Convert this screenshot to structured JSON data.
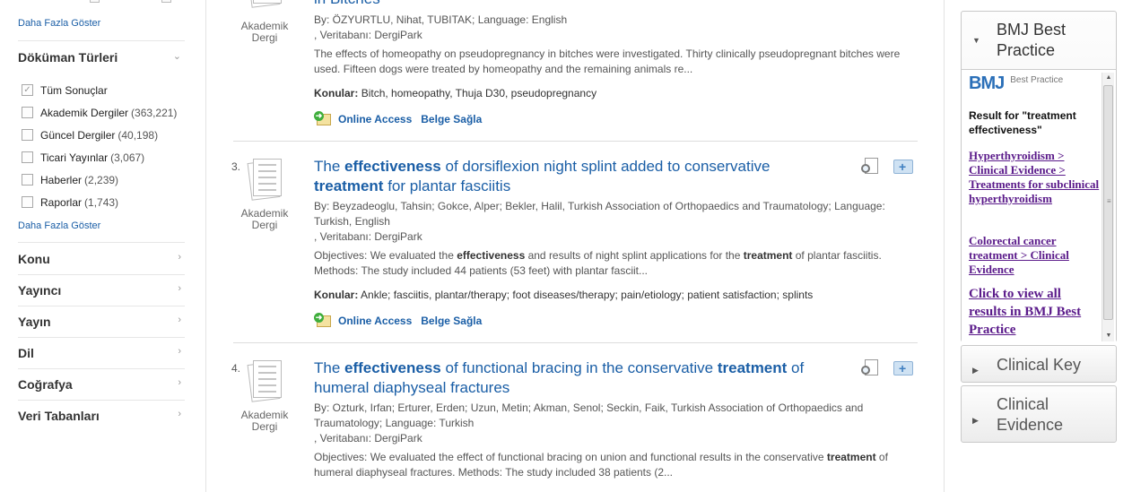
{
  "sidebar": {
    "show_more_top": "Daha Fazla Göster",
    "doc_types_title": "Döküman Türleri",
    "doc_types": [
      {
        "label": "Tüm Sonuçlar",
        "count": ""
      },
      {
        "label": "Akademik Dergiler",
        "count": "(363,221)"
      },
      {
        "label": "Güncel Dergiler",
        "count": "(40,198)"
      },
      {
        "label": "Ticari Yayınlar",
        "count": "(3,067)"
      },
      {
        "label": "Haberler",
        "count": "(2,239)"
      },
      {
        "label": "Raporlar",
        "count": "(1,743)"
      }
    ],
    "show_more": "Daha Fazla Göster",
    "facets": [
      "Konu",
      "Yayıncı",
      "Yayın",
      "Dil",
      "Coğrafya",
      "Veri Tabanları"
    ]
  },
  "results": [
    {
      "number": "",
      "doc_type": "Akademik Dergi",
      "title_tail": "in Bitches",
      "byline": "By: ÖZYURTLU, Nihat, TUBITAK; Language: English",
      "database": ", Veritabanı: DergiPark",
      "abstract": "The effects of homeopathy on pseudopregnancy in bitches were investigated. Thirty clinically pseudopregnant bitches were used. Fifteen dogs were treated by homeopathy and the remaining animals re...",
      "subjects_label": "Konular:",
      "subjects": "Bitch, homeopathy, Thuja D30, pseudopregnancy",
      "online_access": "Online Access",
      "provide_doc": "Belge Sağla"
    },
    {
      "number": "3.",
      "doc_type": "Akademik Dergi",
      "title_parts": [
        "The ",
        "effectiveness",
        " of dorsiflexion night splint added to conservative ",
        "treatment",
        " for plantar fasciitis"
      ],
      "byline": "By: Beyzadeoglu, Tahsin; Gokce, Alper; Bekler, Halil, Turkish Association of Orthopaedics and Traumatology; Language: Turkish, English",
      "database": ", Veritabanı: DergiPark",
      "abstract_parts": [
        "Objectives: We evaluated the ",
        "effectiveness",
        " and results of night splint applications for the ",
        "treatment",
        " of plantar fasciitis. Methods: The study included 44 patients (53 feet) with plantar fasciit..."
      ],
      "subjects_label": "Konular:",
      "subjects": "Ankle; fasciitis, plantar/therapy; foot diseases/therapy; pain/etiology; patient satisfaction; splints",
      "online_access": "Online Access",
      "provide_doc": "Belge Sağla"
    },
    {
      "number": "4.",
      "doc_type": "Akademik Dergi",
      "title_parts": [
        "The ",
        "effectiveness",
        " of functional bracing in the conservative ",
        "treatment",
        " of humeral diaphyseal fractures"
      ],
      "byline": "By: Ozturk, Irfan; Erturer, Erden; Uzun, Metin; Akman, Senol; Seckin, Faik, Turkish Association of Orthopaedics and Traumatology; Language: Turkish",
      "database": ", Veritabanı: DergiPark",
      "abstract_parts": [
        "Objectives: We evaluated the effect of functional bracing on union and functional results in the conservative ",
        "treatment",
        " of humeral diaphyseal fractures. Methods: The study included 38 patients (2..."
      ]
    }
  ],
  "right": {
    "bmj": {
      "title": "BMJ Best Practice",
      "logo_mark": "BMJ",
      "logo_sub": "Best Practice",
      "result_for": "Result for \"treatment effectiveness\"",
      "link1": "Hyperthyroidism > Clinical Evidence > Treatments for subclinical hyperthyroidism",
      "link2": "Colorectal cancer treatment > Clinical Evidence",
      "view_all": "Click to view all results in BMJ Best Practice"
    },
    "clinical_key": "Clinical Key",
    "clinical_evidence": "Clinical Evidence"
  }
}
